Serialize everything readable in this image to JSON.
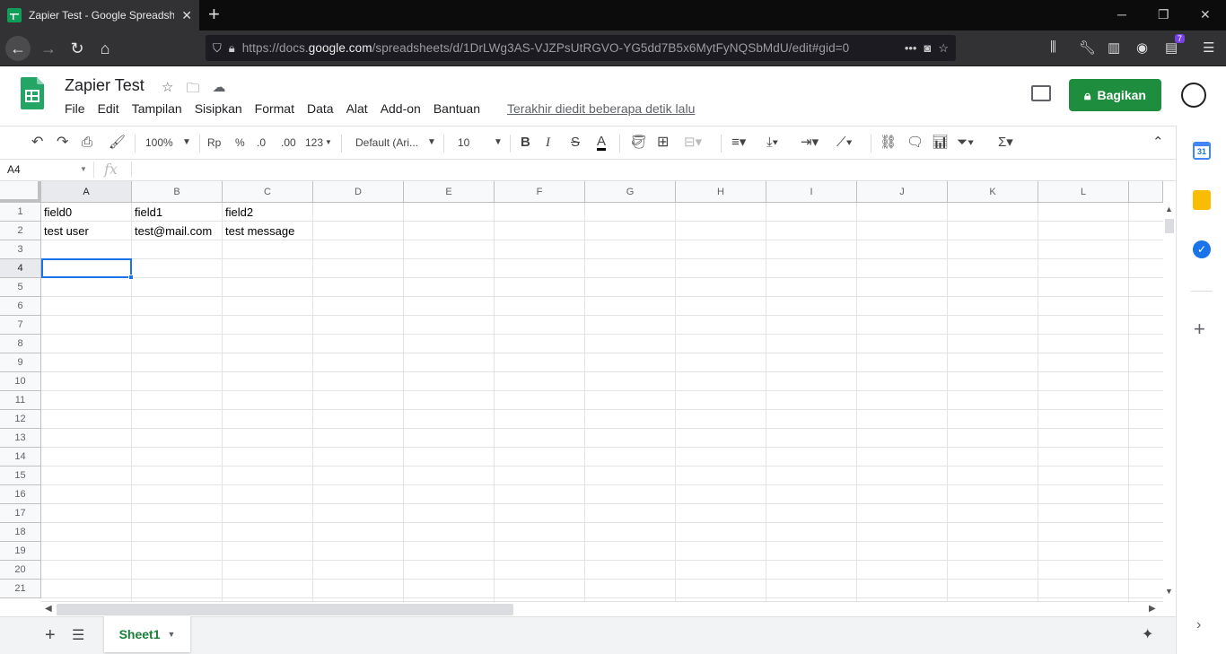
{
  "browser": {
    "tab_title": "Zapier Test - Google Spreadsheets",
    "url_prefix": "https://docs.",
    "url_domain": "google.com",
    "url_path": "/spreadsheets/d/1DrLWg3AS-VJZPsUtRGVO-YG5dd7B5x6MytFyNQSbMdU/edit#gid=0",
    "extension_badge": "7"
  },
  "doc": {
    "title": "Zapier Test",
    "menu": [
      "File",
      "Edit",
      "Tampilan",
      "Sisipkan",
      "Format",
      "Data",
      "Alat",
      "Add-on",
      "Bantuan"
    ],
    "last_edit": "Terakhir diedit beberapa detik lalu",
    "share_label": "Bagikan"
  },
  "toolbar": {
    "zoom": "100%",
    "currency": "Rp",
    "percent": "%",
    "decimal_decrease": ".0",
    "decimal_increase": ".00",
    "more_formats": "123",
    "font": "Default (Ari...",
    "font_size": "10",
    "bold": "B",
    "italic": "I",
    "strike": "S",
    "text_color": "A"
  },
  "formula_bar": {
    "cell_ref": "A4",
    "fx": "fx"
  },
  "sheet": {
    "columns": [
      "A",
      "B",
      "C",
      "D",
      "E",
      "F",
      "G",
      "H",
      "I",
      "J",
      "K",
      "L"
    ],
    "rows": [
      "1",
      "2",
      "3",
      "4",
      "5",
      "6",
      "7",
      "8",
      "9",
      "10",
      "11",
      "12",
      "13",
      "14",
      "15",
      "16",
      "17",
      "18",
      "19",
      "20",
      "21"
    ],
    "cells": {
      "A1": "field0",
      "B1": "field1",
      "C1": "field2",
      "A2": "test user",
      "B2": "test@mail.com",
      "C2": "test message"
    },
    "selected_cell": "A4",
    "tab_name": "Sheet1"
  },
  "side_panel": {
    "calendar_date": "31"
  },
  "colors": {
    "accent_green": "#1e8e3e",
    "selection_blue": "#1a73e8"
  }
}
